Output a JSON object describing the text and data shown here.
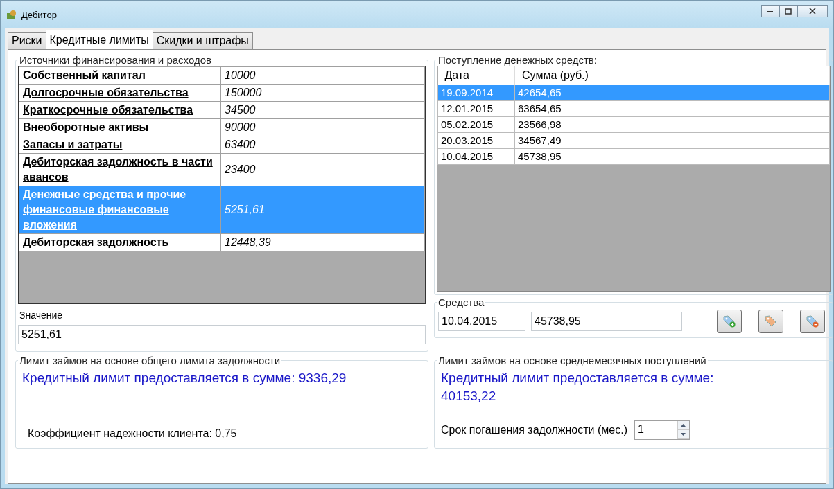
{
  "window": {
    "title": "Дебитор"
  },
  "tabs": [
    {
      "label": "Риски",
      "selected": false
    },
    {
      "label": "Кредитные лимиты",
      "selected": true
    },
    {
      "label": "Скидки и штрафы",
      "selected": false
    }
  ],
  "sources": {
    "title": "Источники финансирования и расходов",
    "rows": [
      {
        "name": "Собственный капитал",
        "value": "10000",
        "selected": false
      },
      {
        "name": "Долгосрочные обязательства",
        "value": "150000",
        "selected": false
      },
      {
        "name": "Краткосрочные обязательства",
        "value": "34500",
        "selected": false
      },
      {
        "name": "Внеоборотные активы",
        "value": "90000",
        "selected": false
      },
      {
        "name": "Запасы и затраты",
        "value": "63400",
        "selected": false
      },
      {
        "name": "Дебиторская задолжность в части авансов",
        "value": "23400",
        "selected": false
      },
      {
        "name": "Денежные средства и прочие финансовые финансовые вложения",
        "value": "5251,61",
        "selected": true
      },
      {
        "name": "Дебиторская задолжность",
        "value": "12448,39",
        "selected": false
      }
    ],
    "value_label": "Значение",
    "value": "5251,61"
  },
  "receipts": {
    "title": "Поступление денежных средств:",
    "columns": [
      "Дата",
      "Сумма (руб.)"
    ],
    "rows": [
      {
        "date": "19.09.2014",
        "amount": "42654,65",
        "selected": true
      },
      {
        "date": "12.01.2015",
        "amount": "63654,65",
        "selected": false
      },
      {
        "date": "05.02.2015",
        "amount": "23566,98",
        "selected": false
      },
      {
        "date": "20.03.2015",
        "amount": "34567,49",
        "selected": false
      },
      {
        "date": "10.04.2015",
        "amount": "45738,95",
        "selected": false
      }
    ]
  },
  "funds": {
    "title": "Средства",
    "date": "10.04.2015",
    "amount": "45738,95",
    "buttons": [
      {
        "kind": "add"
      },
      {
        "kind": "edit"
      },
      {
        "kind": "remove"
      }
    ]
  },
  "limit_total": {
    "title": "Лимит займов на основе общего лимита задолжности",
    "result": "Кредитный лимит предоставляется в сумме: 9336,29",
    "coefficient": "Коэффициент надежности клиента: 0,75"
  },
  "limit_monthly": {
    "title": "Лимит займов на основе среднемесячных поступлений",
    "result": "Кредитный лимит предоставляется в сумме: 40153,22",
    "term_label": "Срок погашения задолжности (мес.)",
    "term_value": "1"
  }
}
